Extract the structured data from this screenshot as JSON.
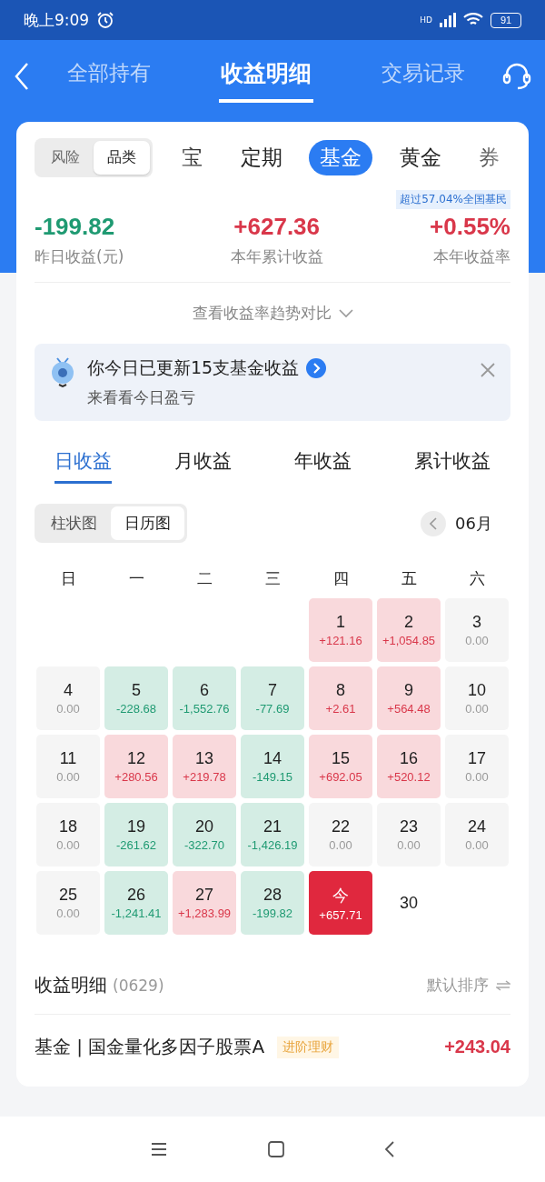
{
  "status_bar": {
    "time": "晚上9:09",
    "network": "HD",
    "battery": "91"
  },
  "header": {
    "tabs": [
      {
        "label": "全部持有",
        "selected": false
      },
      {
        "label": "收益明细",
        "selected": true
      },
      {
        "label": "交易记录",
        "selected": false
      }
    ]
  },
  "filter": {
    "segments": [
      {
        "label": "风险",
        "selected": false
      },
      {
        "label": "品类",
        "selected": true
      }
    ],
    "categories": [
      {
        "label": "宝",
        "selected": false
      },
      {
        "label": "定期",
        "selected": false
      },
      {
        "label": "基金",
        "selected": true
      },
      {
        "label": "黄金",
        "selected": false
      },
      {
        "label": "券",
        "selected": false
      }
    ]
  },
  "rank_badge": "超过57.04%全国基民",
  "stats": [
    {
      "value": "-199.82",
      "label": "昨日收益(元)",
      "color": "#1f9a72"
    },
    {
      "value": "+627.36",
      "label": "本年累计收益",
      "color": "#d9374a"
    },
    {
      "value": "+0.55%",
      "label": "本年收益率",
      "color": "#d9374a"
    }
  ],
  "trend_link": "查看收益率趋势对比",
  "notice": {
    "title": "你今日已更新15支基金收益",
    "subtitle": "来看看今日盈亏"
  },
  "period_tabs": [
    {
      "label": "日收益",
      "selected": true
    },
    {
      "label": "月收益",
      "selected": false
    },
    {
      "label": "年收益",
      "selected": false
    },
    {
      "label": "累计收益",
      "selected": false
    }
  ],
  "view_toggle": [
    {
      "label": "柱状图",
      "selected": false
    },
    {
      "label": "日历图",
      "selected": true
    }
  ],
  "month": "06月",
  "weekdays": [
    "日",
    "一",
    "二",
    "三",
    "四",
    "五",
    "六"
  ],
  "calendar": [
    {
      "day": "1",
      "value": "+121.16",
      "kind": "gain"
    },
    {
      "day": "2",
      "value": "+1,054.85",
      "kind": "gain"
    },
    {
      "day": "3",
      "value": "0.00",
      "kind": "zero"
    },
    {
      "day": "4",
      "value": "0.00",
      "kind": "zero"
    },
    {
      "day": "5",
      "value": "-228.68",
      "kind": "loss"
    },
    {
      "day": "6",
      "value": "-1,552.76",
      "kind": "loss"
    },
    {
      "day": "7",
      "value": "-77.69",
      "kind": "loss"
    },
    {
      "day": "8",
      "value": "+2.61",
      "kind": "gain"
    },
    {
      "day": "9",
      "value": "+564.48",
      "kind": "gain"
    },
    {
      "day": "10",
      "value": "0.00",
      "kind": "zero"
    },
    {
      "day": "11",
      "value": "0.00",
      "kind": "zero"
    },
    {
      "day": "12",
      "value": "+280.56",
      "kind": "gain"
    },
    {
      "day": "13",
      "value": "+219.78",
      "kind": "gain"
    },
    {
      "day": "14",
      "value": "-149.15",
      "kind": "loss"
    },
    {
      "day": "15",
      "value": "+692.05",
      "kind": "gain"
    },
    {
      "day": "16",
      "value": "+520.12",
      "kind": "gain"
    },
    {
      "day": "17",
      "value": "0.00",
      "kind": "zero"
    },
    {
      "day": "18",
      "value": "0.00",
      "kind": "zero"
    },
    {
      "day": "19",
      "value": "-261.62",
      "kind": "loss"
    },
    {
      "day": "20",
      "value": "-322.70",
      "kind": "loss"
    },
    {
      "day": "21",
      "value": "-1,426.19",
      "kind": "loss"
    },
    {
      "day": "22",
      "value": "0.00",
      "kind": "zero"
    },
    {
      "day": "23",
      "value": "0.00",
      "kind": "zero"
    },
    {
      "day": "24",
      "value": "0.00",
      "kind": "zero"
    },
    {
      "day": "25",
      "value": "0.00",
      "kind": "zero"
    },
    {
      "day": "26",
      "value": "-1,241.41",
      "kind": "loss"
    },
    {
      "day": "27",
      "value": "+1,283.99",
      "kind": "gain"
    },
    {
      "day": "28",
      "value": "-199.82",
      "kind": "loss"
    },
    {
      "day": "今",
      "value": "+657.71",
      "kind": "today"
    },
    {
      "day": "30",
      "kind": "future"
    }
  ],
  "detail": {
    "title": "收益明细",
    "date": "(0629)",
    "sort": "默认排序",
    "rows": [
      {
        "name": "基金 | 国金量化多因子股票A",
        "tag": "进阶理财",
        "amount": "+243.04",
        "color": "#d9374a"
      }
    ]
  }
}
